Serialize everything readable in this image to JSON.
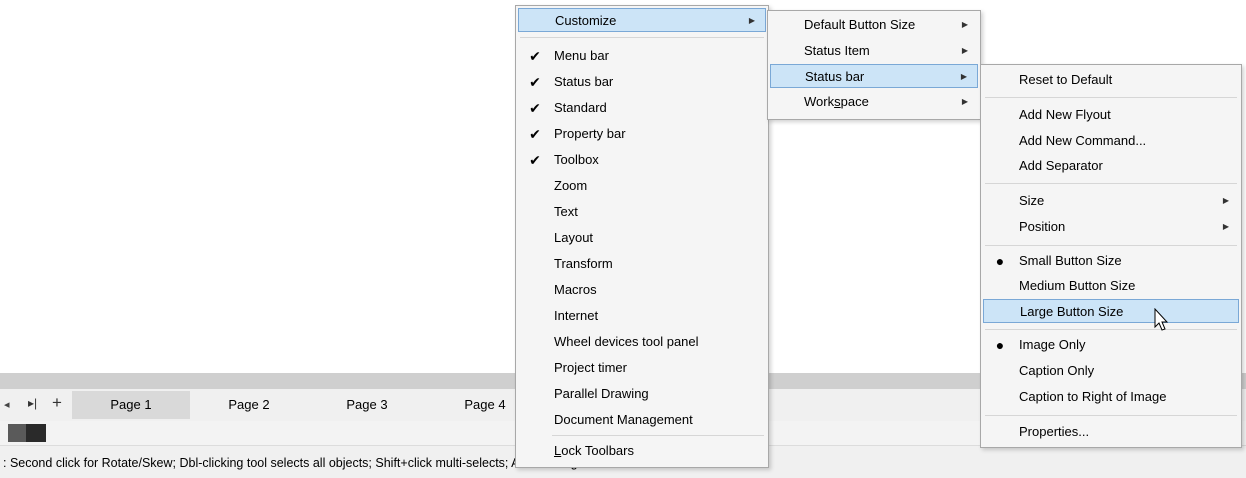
{
  "page_tabs": [
    "Page 1",
    "Page 2",
    "Page 3",
    "Page 4"
  ],
  "nav": {
    "prev_icon": "◂",
    "last_icon": "▸|",
    "add_icon": "+"
  },
  "status_bar_text": ": Second click for Rotate/Skew; Dbl-clicking tool selects all objects; Shift+click multi-selects; Alt+click digs",
  "main_menu": {
    "customize": "Customize",
    "toolbars": [
      {
        "label": "Menu bar",
        "checked": true
      },
      {
        "label": "Status bar",
        "checked": true
      },
      {
        "label": "Standard",
        "checked": true
      },
      {
        "label": "Property bar",
        "checked": true
      },
      {
        "label": "Toolbox",
        "checked": true
      },
      {
        "label": "Zoom",
        "checked": false
      },
      {
        "label": "Text",
        "checked": false
      },
      {
        "label": "Layout",
        "checked": false
      },
      {
        "label": "Transform",
        "checked": false
      },
      {
        "label": "Macros",
        "checked": false
      },
      {
        "label": "Internet",
        "checked": false
      },
      {
        "label": "Wheel devices tool panel",
        "checked": false
      },
      {
        "label": "Project timer",
        "checked": false
      },
      {
        "label": "Parallel Drawing",
        "checked": false
      },
      {
        "label": "Document Management",
        "checked": false
      }
    ],
    "lock_toolbars": "Lock Toolbars",
    "lock_mnemonic": "L",
    "lock_rest": "ock Toolbars"
  },
  "customize_menu": {
    "items": [
      "Default Button Size",
      "Status Item",
      "Status bar",
      "Workspace"
    ],
    "workspace_pre": "Work",
    "workspace_mn": "s",
    "workspace_post": "pace"
  },
  "statusbar_menu": {
    "reset": "Reset to Default",
    "add_flyout": "Add New Flyout",
    "add_command": "Add New Command...",
    "add_separator": "Add Separator",
    "size": "Size",
    "position": "Position",
    "small": "Small Button Size",
    "medium": "Medium Button Size",
    "large": "Large Button Size",
    "image_only": "Image Only",
    "caption_only": "Caption Only",
    "caption_right": "Caption to Right of Image",
    "properties": "Properties..."
  },
  "colors": {
    "highlight": "#cce4f7",
    "highlight_border": "#7aa8d6",
    "menu_bg": "#f5f5f5"
  }
}
